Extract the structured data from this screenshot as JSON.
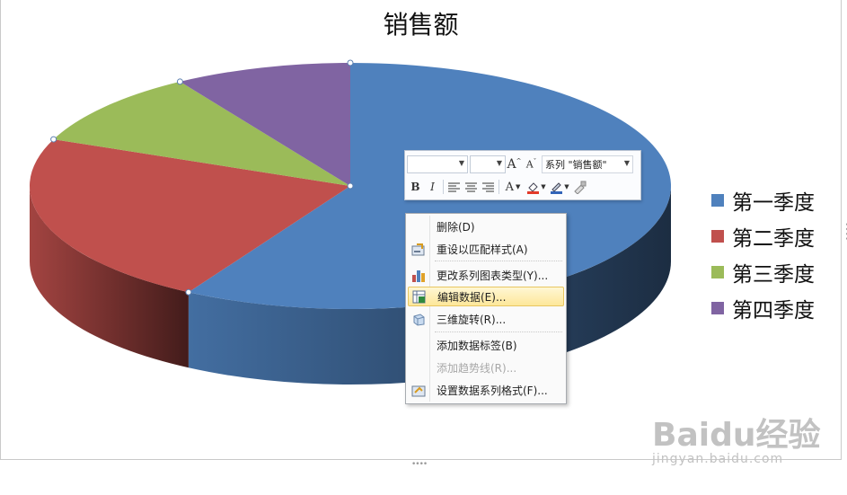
{
  "chart": {
    "title": "销售额",
    "legend": [
      {
        "label": "第一季度",
        "color": "#4f81bd"
      },
      {
        "label": "第二季度",
        "color": "#c0504d"
      },
      {
        "label": "第三季度",
        "color": "#9bbb59"
      },
      {
        "label": "第四季度",
        "color": "#8064a2"
      }
    ]
  },
  "chart_data": {
    "type": "pie",
    "title": "销售额",
    "categories": [
      "第一季度",
      "第二季度",
      "第三季度",
      "第四季度"
    ],
    "values": [
      59,
      23,
      10,
      9
    ],
    "colors": [
      "#4f81bd",
      "#c0504d",
      "#9bbb59",
      "#8064a2"
    ],
    "style": "3d",
    "legend_position": "right"
  },
  "mini_toolbar": {
    "font_name": "",
    "font_size": "",
    "grow_font_icon": "A↑",
    "shrink_font_icon": "A↓",
    "series_select": "系列 \"销售额\"",
    "bold": "B",
    "italic": "I",
    "font_color_icon": "A",
    "icons": [
      "align-left-icon",
      "align-center-icon",
      "align-right-icon",
      "fill-color-icon",
      "line-color-icon",
      "format-painter-icon"
    ]
  },
  "context_menu": {
    "items": [
      {
        "label": "删除(D)",
        "icon": "",
        "disabled": false
      },
      {
        "label": "重设以匹配样式(A)",
        "icon": "reset-style-icon",
        "disabled": false
      },
      {
        "label": "更改系列图表类型(Y)...",
        "icon": "chart-type-icon",
        "disabled": false
      },
      {
        "label": "编辑数据(E)...",
        "icon": "edit-data-icon",
        "disabled": false,
        "highlighted": true
      },
      {
        "label": "三维旋转(R)...",
        "icon": "3d-rotation-icon",
        "disabled": false
      },
      {
        "label": "添加数据标签(B)",
        "icon": "",
        "disabled": false
      },
      {
        "label": "添加趋势线(R)...",
        "icon": "",
        "disabled": true
      },
      {
        "label": "设置数据系列格式(F)...",
        "icon": "format-series-icon",
        "disabled": false
      }
    ]
  },
  "watermark": {
    "logo": "Baidu经验",
    "url": "jingyan.baidu.com"
  }
}
